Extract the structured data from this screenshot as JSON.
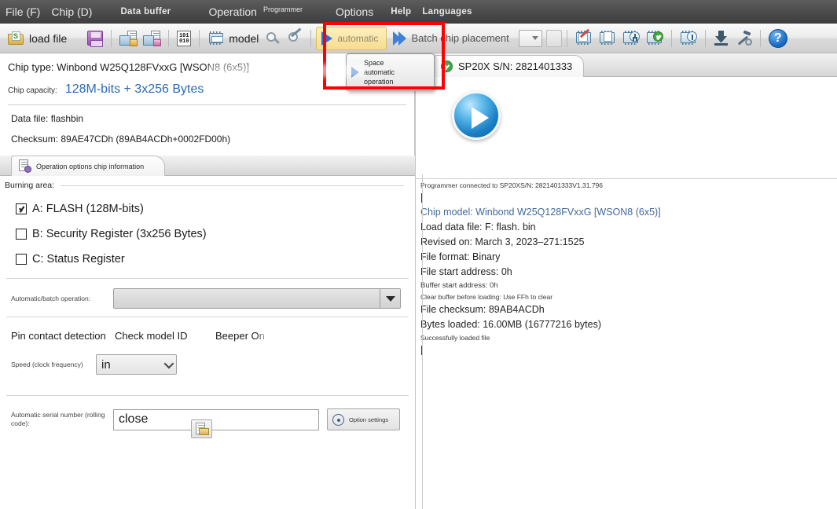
{
  "menu": {
    "items": [
      {
        "label": "File (F)",
        "size": "normal"
      },
      {
        "label": "Chip (D)",
        "size": "normal"
      },
      {
        "label": "Data buffer",
        "size": "small"
      },
      {
        "label": "Operation",
        "size": "normal"
      },
      {
        "label": "Programmer",
        "size": "tiny"
      },
      {
        "label": "Options",
        "size": "normal"
      },
      {
        "label": "Help",
        "size": "normal"
      },
      {
        "label": "Languages",
        "size": "normal"
      }
    ]
  },
  "toolbar": {
    "load_file_label": "load file",
    "model_label": "model",
    "automatic_label": "automatic",
    "batch_label": "Batch chip placement",
    "help_glyph": "?",
    "bin_line1": "101",
    "bin_line2": "010",
    "icons": {
      "load_file": "open-folder-icon",
      "save": "floppy-save-icon",
      "load_buffer": "chip-to-file-icon",
      "save_buffer": "file-to-chip-icon",
      "data_buffer": "binary-buffer-icon",
      "model": "chip-model-icon",
      "search": "magnifier-icon",
      "auto_detect": "wand-chip-icon",
      "erase": "chip-erase-icon",
      "blank_check": "chip-blank-check-icon",
      "program": "chip-program-icon",
      "verify": "chip-verify-icon",
      "read": "chip-read-icon",
      "download": "download-icon",
      "tools": "hammer-gear-icon",
      "help": "help-icon"
    }
  },
  "popup": {
    "line1": "Space",
    "line2": "automatic",
    "line3": "operation"
  },
  "left_panel": {
    "chip_type": "Chip type: Winbond W25Q128FVxxG [WSON8 (6x5)]",
    "capacity_label": "Chip capacity:",
    "capacity_value": "128M-bits + 3x256 Bytes",
    "data_file": "Data file: flashbin",
    "checksum": "Checksum: 89AE47CDh (89AB4ACDh+0002FD00h)",
    "tab_label": "Operation options chip information",
    "burning_area_label": "Burning area:",
    "checkboxes": [
      {
        "label": "A: FLASH (128M-bits)",
        "checked": true
      },
      {
        "label": "B: Security Register (3x256 Bytes)",
        "checked": false
      },
      {
        "label": "C: Status Register",
        "checked": false
      }
    ],
    "auto_batch_label": "Automatic/batch operation:",
    "auto_batch_value": "",
    "option_pin_contact": "Pin contact detection",
    "option_check_model": "Check model ID",
    "option_beeper": "Beeper On",
    "speed_label": "Speed (clock frequency)",
    "speed_value": "in",
    "serial_label": "Automatic serial number (rolling code):",
    "serial_value": "close",
    "option_settings_label": "Option settings"
  },
  "right_panel": {
    "device_tab": "SP20X  S/N: 2821401333",
    "log": [
      {
        "text": "Programmer connected to SP20XS/N: 2821401333V1.31.796",
        "style": "xs"
      },
      {
        "text": "Chip model: Winbond W25Q128FVxxG [WSON8 (6x5)]",
        "style": "blue"
      },
      {
        "text": "Load data file: F:  flash. bin",
        "style": "md"
      },
      {
        "text": "Revised on: March 3, 2023–271:1525",
        "style": "md"
      },
      {
        "text": "File format: Binary",
        "style": "md"
      },
      {
        "text": "File start address: 0h",
        "style": "md"
      },
      {
        "text": "Buffer start address: 0h",
        "style": "sm"
      },
      {
        "text": "Clear buffer before loading: Use FFh to clear",
        "style": "xs"
      },
      {
        "text": "File checksum: 89AB4ACDh",
        "style": "md"
      },
      {
        "text": "Bytes loaded: 16.00MB (16777216 bytes)",
        "style": "md"
      },
      {
        "text": "Successfully loaded file",
        "style": "xs"
      }
    ]
  },
  "colors": {
    "menu_bg": "#4a4a4a",
    "accent_blue": "#2a6bb5",
    "highlight_yellow": "#f7dc8e",
    "annotation_red": "#ff0000",
    "success_green": "#41a845"
  }
}
